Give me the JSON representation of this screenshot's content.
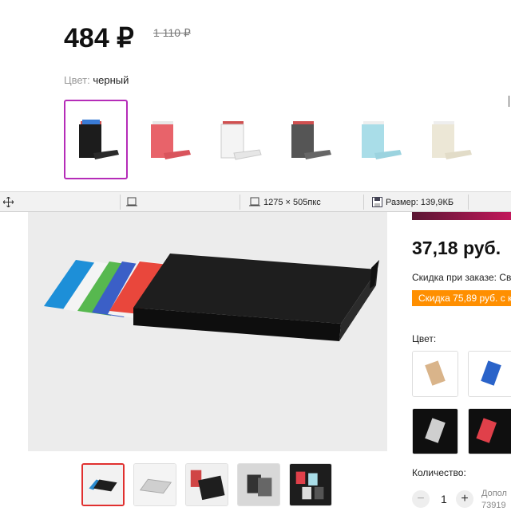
{
  "top_panel": {
    "price": "484 ₽",
    "old_price": "1 110 ₽",
    "color_label": "Цвет:",
    "color_value": "черный",
    "swatches": [
      {
        "color": "#1c1c1c",
        "selected": true
      },
      {
        "color": "#e8636a",
        "selected": false
      },
      {
        "color": "#f2f2f2",
        "selected": false
      },
      {
        "color": "#555555",
        "selected": false
      },
      {
        "color": "#a9dde8",
        "selected": false
      },
      {
        "color": "#ece7d6",
        "selected": false
      }
    ],
    "accent_color": "#b52cb8"
  },
  "status_bar": {
    "dimensions": "1275 × 505пкс",
    "size": "Размер: 139,9КБ"
  },
  "shop": {
    "price": "37,18 руб.",
    "discount_text": "Скидка при заказе: Св",
    "discount_badge": "Скидка 75,89 руб. с ка",
    "color_label": "Цвет:",
    "quantity_label": "Количество:",
    "quantity_value": "1",
    "qty_minus": "−",
    "qty_plus": "+",
    "extra_line1": "Допол",
    "extra_line2": "73919",
    "badge_color": "#ff8f00",
    "selected_thumb_color": "#e0302f",
    "variants": [
      {
        "color": "#d9b48a"
      },
      {
        "color": "#2a63c9"
      },
      {
        "color": "#cfcfcf"
      },
      {
        "color": "#e0404a"
      }
    ]
  }
}
